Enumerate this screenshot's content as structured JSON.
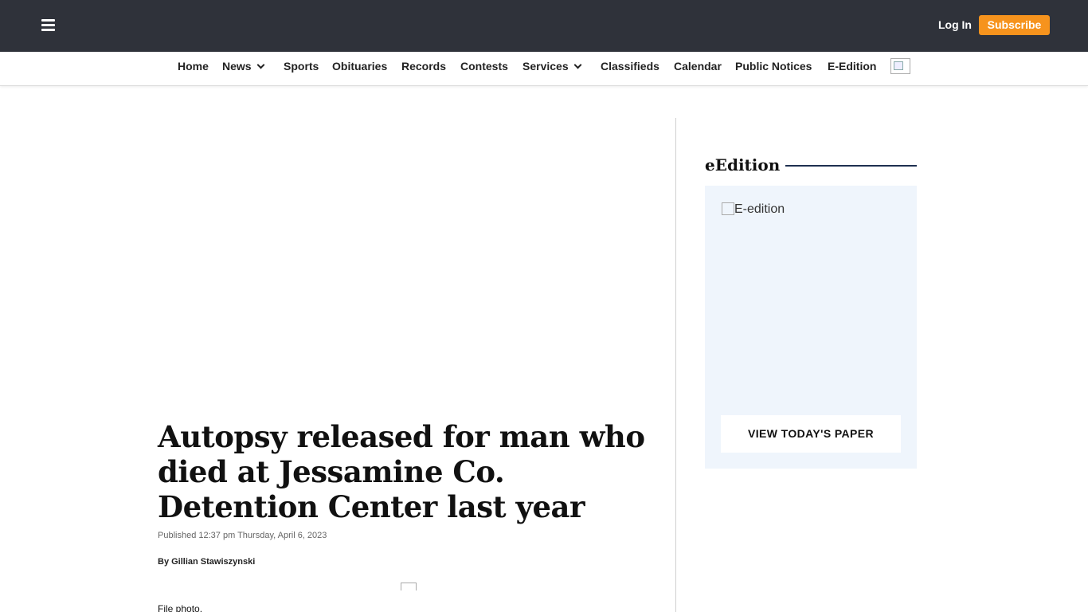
{
  "header": {
    "login_label": "Log In",
    "subscribe_label": "Subscribe",
    "accent_color": "#f6931d",
    "bar_color": "#2f323a"
  },
  "nav": {
    "items": [
      {
        "label": "Home"
      },
      {
        "label": "News",
        "dropdown": true
      },
      {
        "label": "Sports"
      },
      {
        "label": "Obituaries"
      },
      {
        "label": "Records"
      },
      {
        "label": "Contests"
      },
      {
        "label": "Services",
        "dropdown": true
      },
      {
        "label": "Classifieds"
      },
      {
        "label": "Calendar"
      },
      {
        "label": "Public Notices"
      },
      {
        "label": "E-Edition"
      }
    ]
  },
  "article": {
    "headline": "Autopsy released for man who died at Jessamine Co. Detention Center last year",
    "published": "Published 12:37 pm Thursday, April 6, 2023",
    "byline": "By Gillian Stawiszynski",
    "caption": "File photo."
  },
  "sidebar": {
    "title": "eEdition",
    "image_alt": "E-edition",
    "button_label": "VIEW TODAY'S PAPER",
    "rule_color": "#1e3050",
    "box_color": "#eff5fc"
  }
}
